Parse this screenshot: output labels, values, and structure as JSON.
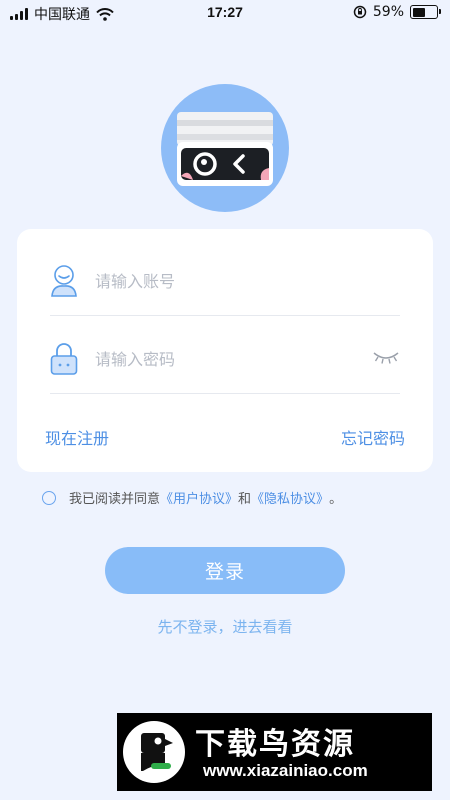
{
  "status_bar": {
    "carrier": "中国联通",
    "time": "17:27",
    "battery_percent": "59%",
    "battery_level": 0.59,
    "icons": [
      "signal-icon",
      "wifi-icon",
      "orientation-lock-icon",
      "battery-icon"
    ]
  },
  "login": {
    "account_placeholder": "请输入账号",
    "password_placeholder": "请输入密码",
    "register_label": "现在注册",
    "forgot_label": "忘记密码",
    "agreement_prefix": "我已阅读并同意",
    "user_agreement": "《用户协议》",
    "agreement_and": "和",
    "privacy_policy": "《隐私协议》",
    "agreement_suffix": "。",
    "login_button": "登录",
    "skip_label": "先不登录，进去看看"
  },
  "watermark": {
    "title": "下载鸟资源",
    "url": "www.xiazainiao.com"
  },
  "colors": {
    "background": "#eef3fe",
    "accent": "#4d8fe4",
    "button": "#88bcf8",
    "logo_circle": "#8dbcf7"
  }
}
